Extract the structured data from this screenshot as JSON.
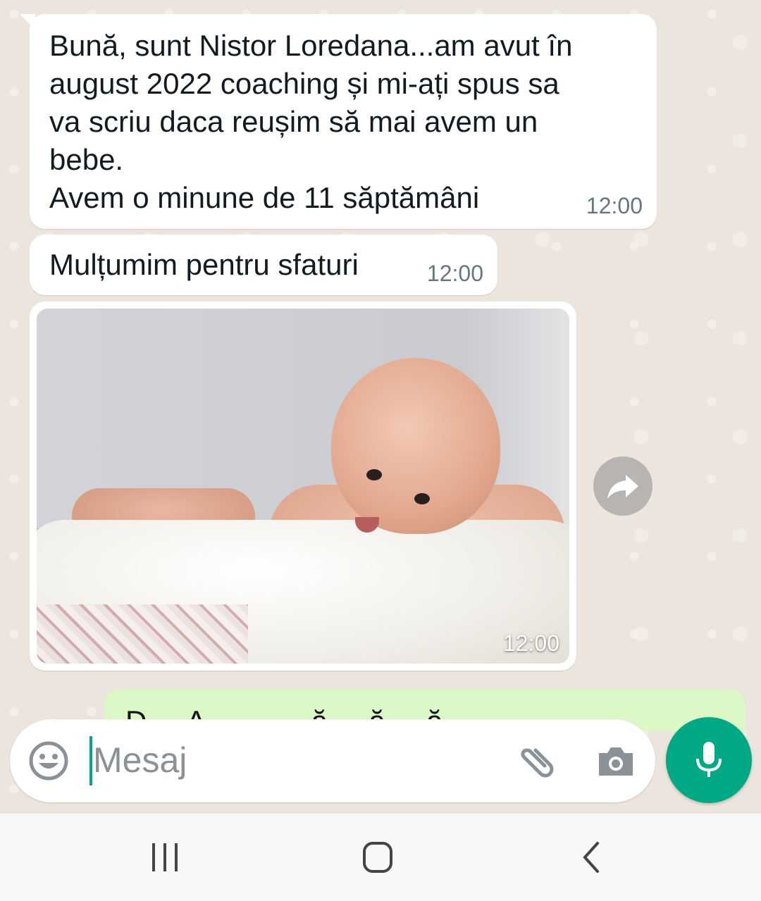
{
  "messages": [
    {
      "text": "Bună, sunt Nistor Loredana...am avut în\naugust 2022 coaching și mi-ați spus sa\nva scriu daca reușim să mai avem un\nbebe.\nAvem o minune de 11 săptămâni",
      "time": "12:00"
    },
    {
      "text": "Mulțumim pentru sfaturi",
      "time": "12:00"
    },
    {
      "type": "photo",
      "time": "12:00"
    }
  ],
  "outgoing_peek": "D ... A ... ... ... ă ... ă ... ă ...",
  "composer": {
    "placeholder": "Mesaj"
  },
  "colors": {
    "accent": "#00a884",
    "chat_background": "#ece5dd",
    "incoming_bubble": "#ffffff",
    "outgoing_bubble": "#dcf8c6"
  },
  "icons": [
    "emoji-icon",
    "attach-icon",
    "camera-icon",
    "mic-icon",
    "forward-icon",
    "recents-icon",
    "home-icon",
    "back-icon"
  ]
}
